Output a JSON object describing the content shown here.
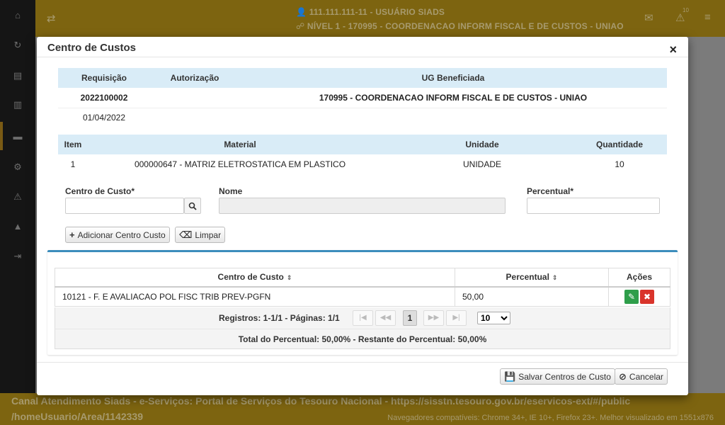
{
  "background": {
    "header": {
      "user_line": "111.111.111-11 - USUÁRIO SIADS",
      "level_line": "NÍVEL 1 - 170995 - COORDENACAO INFORM FISCAL E DE CUSTOS - UNIAO",
      "alerts_badge": "10"
    },
    "footer": {
      "line1": "Canal Atendimento Siads - e-Serviços: Portal de Serviços do Tesouro Nacional - https://sisstn.tesouro.gov.br/eservicos-ext/#/public",
      "line2": "/homeUsuario/Area/1142339",
      "browsers": "Navegadores compatíveis: Chrome 34+, IE 10+, Firefox 23+. Melhor visualizado em 1551x876"
    }
  },
  "modal": {
    "title": "Centro de Custos",
    "close_glyph": "×",
    "info": {
      "headers": [
        "Requisição",
        "Autorização",
        "UG Beneficiada"
      ],
      "requisicao": "2022100002",
      "autorizacao": "",
      "ug": "170995 - COORDENACAO INFORM FISCAL E DE CUSTOS - UNIAO",
      "date": "01/04/2022"
    },
    "items": {
      "headers": [
        "Item",
        "Material",
        "Unidade",
        "Quantidade"
      ],
      "rows": [
        {
          "item": "1",
          "material": "000000647 - MATRIZ ELETROSTATICA EM PLASTICO",
          "unidade": "UNIDADE",
          "quantidade": "10"
        }
      ]
    },
    "form": {
      "centro_label": "Centro de Custo*",
      "centro_value": "",
      "nome_label": "Nome",
      "nome_value": "",
      "percentual_label": "Percentual*",
      "percentual_value": ""
    },
    "buttons": {
      "add": "Adicionar Centro Custo",
      "clear": "Limpar",
      "save": "Salvar Centros de Custo",
      "cancel": "Cancelar"
    },
    "grid": {
      "headers": [
        "Centro de Custo",
        "Percentual",
        "Ações"
      ],
      "rows": [
        {
          "centro": "10121 - F. E AVALIACAO POL FISC TRIB PREV-PGFN",
          "percentual": "50,00"
        }
      ],
      "pager": {
        "records": "Registros: 1-1/1 - Páginas: 1/1",
        "current_page": "1",
        "page_size": "10"
      },
      "totals": "Total do Percentual: 50,00%    -    Restante do Percentual: 50,00%"
    }
  },
  "colors": {
    "header_bg": "#7d6410",
    "table_header": "#d9ecf7",
    "panel_accent": "#3c8dbc",
    "edit": "#2e9e4a",
    "delete": "#d9342b"
  }
}
